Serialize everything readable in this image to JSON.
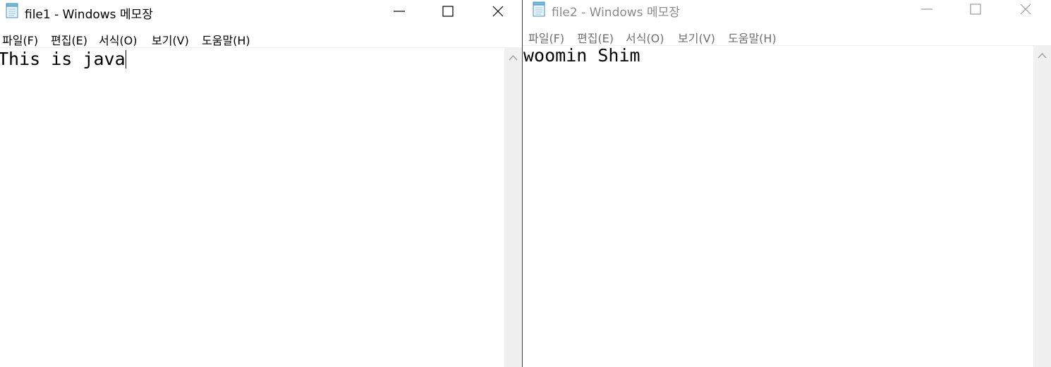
{
  "windows": [
    {
      "title": "file1 - Windows 메모장",
      "menu": [
        "파일(F)",
        "편집(E)",
        "서식(O)",
        "보기(V)",
        "도움말(H)"
      ],
      "content": "This is java",
      "active": true
    },
    {
      "title": "file2 - Windows 메모장",
      "menu": [
        "파일(F)",
        "편집(E)",
        "서식(O)",
        "보기(V)",
        "도움말(H)"
      ],
      "content": "woomin Shim",
      "active": false
    }
  ],
  "icons": {
    "app": "notepad-icon",
    "minimize": "minimize-icon",
    "maximize": "maximize-icon",
    "close": "close-icon",
    "scroll_up": "chevron-up-icon"
  },
  "colors": {
    "active_title_text": "#000000",
    "inactive_title_text": "#8a8a8a",
    "scrollbar_track": "#f0f0f0",
    "window_divider": "#3c3c3c"
  }
}
